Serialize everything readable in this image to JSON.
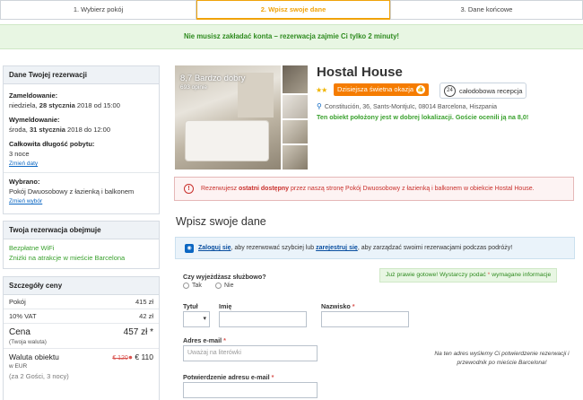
{
  "steps": [
    {
      "label": "1. Wybierz pokój"
    },
    {
      "label": "2. Wpisz swoje dane"
    },
    {
      "label": "3. Dane końcowe"
    }
  ],
  "banner": "Nie musisz zakładać konta – rezerwacja zajmie Ci tylko 2 minuty!",
  "booking": {
    "title": "Dane Twojej rezerwacji",
    "checkin_label": "Zameldowanie:",
    "checkin_day": "niedziela, ",
    "checkin_date": "28 stycznia",
    "checkin_rest": " 2018 od 15:00",
    "checkout_label": "Wymeldowanie:",
    "checkout_day": "środa, ",
    "checkout_date": "31 stycznia",
    "checkout_rest": " 2018 do 12:00",
    "length_label": "Całkowita długość pobytu:",
    "length_value": "3 noce",
    "change_dates": "Zmień daty",
    "chosen_label": "Wybrano:",
    "chosen_value": "Pokój Dwuosobowy z łazienką i balkonem",
    "change_choice": "Zmień wybór"
  },
  "includes": {
    "title": "Twoja rezerwacja obejmuje",
    "items": [
      "Bezpłatne WiFi",
      "Zniżki na atrakcje w mieście Barcelona"
    ]
  },
  "price": {
    "title": "Szczegóły ceny",
    "rows": [
      {
        "label": "Pokój",
        "value": "415 zł"
      },
      {
        "label": "10% VAT",
        "value": "42 zł"
      }
    ],
    "total_label": "Cena",
    "total_value": "457 zł *",
    "total_sub": "(Twoja waluta)",
    "local_label": "Waluta obiektu",
    "local_sub": "w EUR",
    "local_old": "€ 120",
    "local_new": "€ 110",
    "guests": "(za 2 Gości, 3 nocy)"
  },
  "hotel": {
    "rating": "8,7 Bardzo dobry",
    "reviews": "693 opinie",
    "name": "Hostal House",
    "stars": "★★",
    "deal": "Dzisiejsza świetna okazja",
    "reception": "całodobowa recepcja",
    "address": "Constitución, 36, Sants-Montjuïc, 08014 Barcelona, Hiszpania",
    "location_note": "Ten obiekt położony jest w dobrej lokalizacji. Goście ocenili ją na 8,0!"
  },
  "alert": {
    "pre": "Rezerwujesz ",
    "bold": "ostatni dostępny",
    "post": " przez naszą stronę Pokój Dwuosobowy z łazienką i balkonem w obiekcie Hostal House."
  },
  "form": {
    "title": "Wpisz swoje dane",
    "login_link": "Zaloguj się",
    "login_mid": ", aby rezerwować szybciej lub ",
    "register_link": "zarejestruj się",
    "login_end": ", aby zarządzać swoimi rezerwacjami podczas podróży!",
    "note_pre": "Już prawie gotowe! Wystarczy podać ",
    "note_star": "*",
    "note_post": " wymagane informacje",
    "business_q": "Czy wyjeżdżasz służbowo?",
    "opt_yes": "Tak",
    "opt_no": "Nie",
    "title_label": "Tytuł",
    "first_label": "Imię",
    "last_label": "Nazwisko",
    "email_label": "Adres e-mail",
    "email_placeholder": "Uważaj na literówki",
    "confirm_label": "Potwierdzenie adresu e-mail",
    "email_note": "Na ten adres wyślemy Ci potwierdzenie rezerwacji i przewodnik po mieście Barcelona!"
  }
}
